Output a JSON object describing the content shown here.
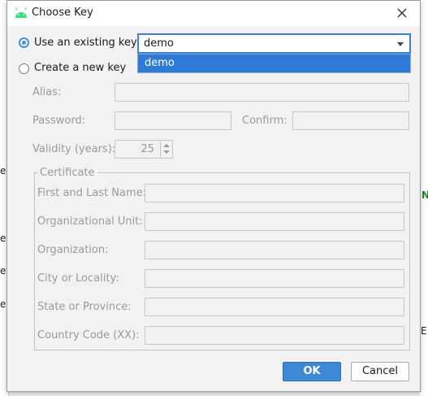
{
  "background": {
    "left_fragments": [
      "ey",
      "ey",
      "ey",
      "ey"
    ],
    "right_fragments": [
      "N",
      "E"
    ]
  },
  "dialog": {
    "title": "Choose Key",
    "title_icon": "android-icon",
    "close_icon": "close-icon"
  },
  "options": {
    "existing_label": "Use an existing key:",
    "new_label": "Create a new key"
  },
  "existing_key": {
    "selected": "demo",
    "dropdown_items": [
      "demo"
    ]
  },
  "new_key": {
    "alias_label": "Alias:",
    "password_label": "Password:",
    "confirm_label": "Confirm:",
    "validity_label": "Validity (years):",
    "validity_value": "25"
  },
  "certificate": {
    "title": "Certificate",
    "fields": [
      {
        "label": "First and Last Name:"
      },
      {
        "label": "Organizational Unit:"
      },
      {
        "label": "Organization:"
      },
      {
        "label": "City or Locality:"
      },
      {
        "label": "State or Province:"
      },
      {
        "label": "Country Code (XX):"
      }
    ]
  },
  "buttons": {
    "ok": "OK",
    "cancel": "Cancel"
  },
  "colors": {
    "accent": "#3e88d6",
    "selection": "#2d7bd6",
    "android": "#3ddc84"
  }
}
